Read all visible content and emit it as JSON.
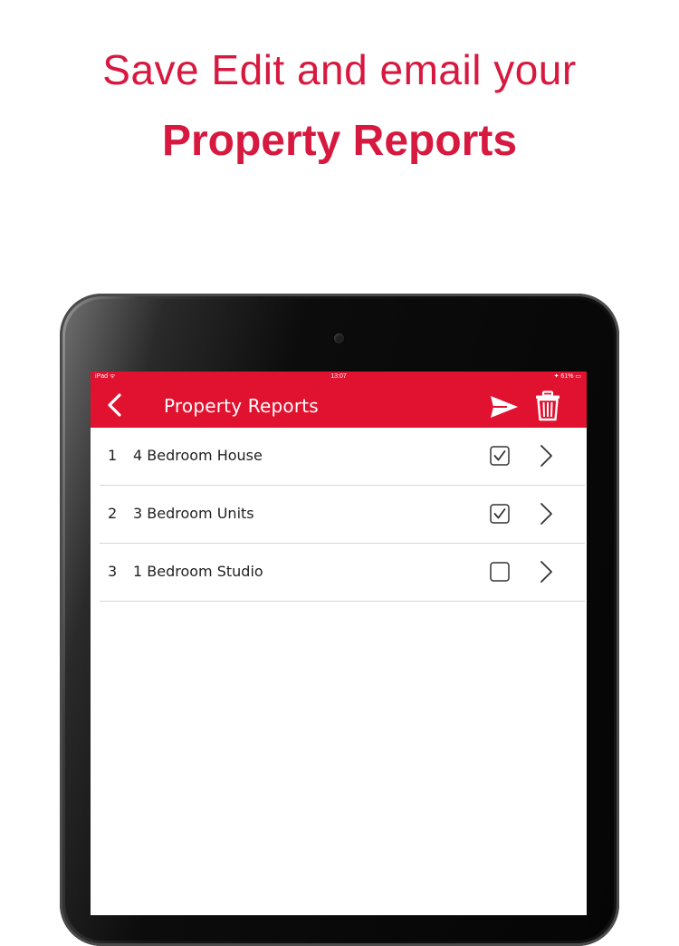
{
  "headline": {
    "line1": "Save Edit and email your",
    "line2": "Property Reports"
  },
  "status_bar": {
    "carrier": "iPad ᯤ",
    "time": "13:07",
    "battery": "✦ 61% ▭"
  },
  "nav": {
    "title": "Property Reports",
    "back_icon": "chevron-left-icon",
    "send_icon": "send-icon",
    "delete_icon": "trash-icon"
  },
  "reports": [
    {
      "number": "1",
      "name": "4 Bedroom House",
      "checked": true
    },
    {
      "number": "2",
      "name": "3 Bedroom Units",
      "checked": true
    },
    {
      "number": "3",
      "name": "1 Bedroom Studio",
      "checked": false
    }
  ],
  "colors": {
    "accent": "#e0122f",
    "headline": "#d7183f"
  }
}
